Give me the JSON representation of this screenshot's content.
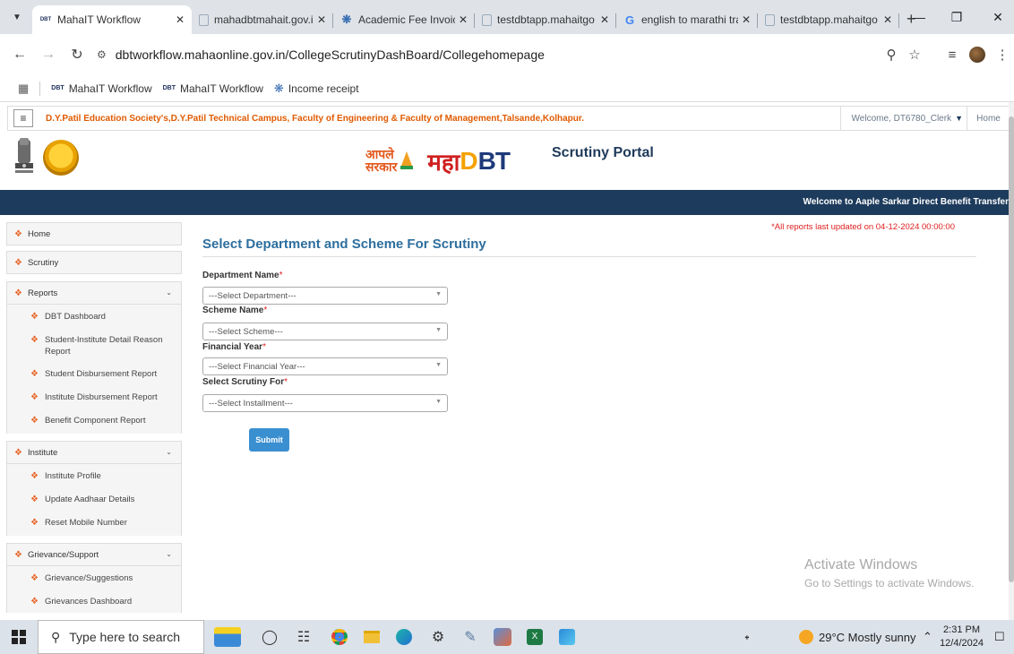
{
  "browser": {
    "tabs": [
      {
        "title": "MahaIT Workflow",
        "favicon": "dbt-icon",
        "active": true
      },
      {
        "title": "mahadbtmahait.gov.i",
        "favicon": "page-icon"
      },
      {
        "title": "Academic Fee Invoice",
        "favicon": "gear-icon"
      },
      {
        "title": "testdbtapp.mahaitgo",
        "favicon": "page-icon"
      },
      {
        "title": "english to marathi tra",
        "favicon": "google-icon"
      },
      {
        "title": "testdbtapp.mahaitgo",
        "favicon": "page-icon"
      }
    ],
    "url": "dbtworkflow.mahaonline.gov.in/CollegeScrutinyDashBoard/Collegehomepage",
    "bookmarks": [
      {
        "label": "MahaIT Workflow",
        "badge": "DBT"
      },
      {
        "label": "MahaIT Workflow",
        "badge": "DBT"
      },
      {
        "label": "Income receipt",
        "badge": ""
      }
    ]
  },
  "page": {
    "institute": "D.Y.Patil Education Society's,D.Y.Patil Technical Campus, Faculty of Engineering & Faculty of Management,Talsande,Kolhapur.",
    "welcome_user": "Welcome, DT6780_Clerk",
    "home_link": "Home",
    "logo": {
      "aaple": "आपले",
      "sarkar": "सरकार",
      "maha": "महा",
      "dbt_d": "D",
      "dbt_bt": "BT"
    },
    "portal_title": "Scrutiny Portal",
    "nav_welcome": "Welcome to Aaple Sarkar Direct Benefit Transfer",
    "updated_note": "*All reports last updated on 04-12-2024 00:00:00",
    "section_title": "Select Department and Scheme For Scrutiny",
    "fields": [
      {
        "label": "Department Name",
        "placeholder": "---Select Department---"
      },
      {
        "label": "Scheme Name",
        "placeholder": "---Select Scheme---"
      },
      {
        "label": "Financial Year",
        "placeholder": "---Select Financial Year---"
      },
      {
        "label": "Select Scrutiny For",
        "placeholder": "---Select Installment---"
      }
    ],
    "required_mark": "*",
    "submit_label": "Submit"
  },
  "sidebar": {
    "home": "Home",
    "scrutiny": "Scrutiny",
    "reports": "Reports",
    "reports_items": [
      "DBT Dashboard",
      "Student-Institute Detail Reason Report",
      "Student Disbursement Report",
      "Institute Disbursement Report",
      "Benefit Component Report"
    ],
    "institute": "Institute",
    "institute_items": [
      "Institute Profile",
      "Update Aadhaar Details",
      "Reset Mobile Number"
    ],
    "grievance": "Grievance/Support",
    "grievance_items": [
      "Grievance/Suggestions",
      "Grievances Dashboard"
    ]
  },
  "watermark": {
    "line1": "Activate Windows",
    "line2": "Go to Settings to activate Windows."
  },
  "taskbar": {
    "search_placeholder": "Type here to search",
    "weather": "29°C  Mostly sunny",
    "time": "2:31 PM",
    "date": "12/4/2024"
  },
  "colors": {
    "nav_band": "#1d3b5c",
    "title": "#2d6e9e",
    "accent": "#e8662a",
    "submit": "#3a8fd1",
    "institute_text": "#e05a00"
  }
}
